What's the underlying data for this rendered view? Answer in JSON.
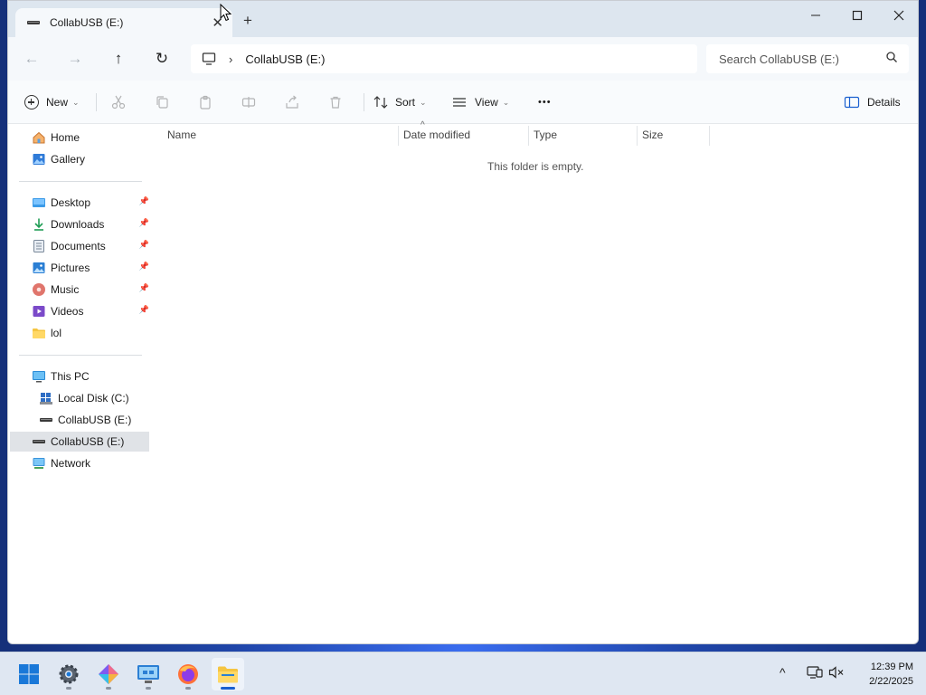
{
  "window": {
    "tab_title": "CollabUSB (E:)",
    "new_tab": "+",
    "minimize": "—",
    "maximize": "☐",
    "close": "✕"
  },
  "nav": {
    "back": "←",
    "forward": "→",
    "up": "↑",
    "refresh": "↻",
    "path_separator": "›",
    "path": "CollabUSB (E:)",
    "search_placeholder": "Search CollabUSB (E:)"
  },
  "commandbar": {
    "new_label": "New",
    "sort_label": "Sort",
    "view_label": "View",
    "more_label": "•••",
    "details_label": "Details",
    "dropdown_caret": "⌄"
  },
  "sidebar": {
    "quick": [
      {
        "label": "Home",
        "icon": "home-icon"
      },
      {
        "label": "Gallery",
        "icon": "gallery-icon"
      }
    ],
    "pinned": [
      {
        "label": "Desktop",
        "icon": "desktop-folder-icon",
        "pinned": true
      },
      {
        "label": "Downloads",
        "icon": "downloads-folder-icon",
        "pinned": true
      },
      {
        "label": "Documents",
        "icon": "documents-folder-icon",
        "pinned": true
      },
      {
        "label": "Pictures",
        "icon": "pictures-folder-icon",
        "pinned": true
      },
      {
        "label": "Music",
        "icon": "music-folder-icon",
        "pinned": true
      },
      {
        "label": "Videos",
        "icon": "videos-folder-icon",
        "pinned": true
      },
      {
        "label": "lol",
        "icon": "folder-icon",
        "pinned": false
      }
    ],
    "pin_glyph": "📌",
    "devices": [
      {
        "label": "This PC",
        "icon": "this-pc-icon"
      },
      {
        "label": "Local Disk (C:)",
        "icon": "local-disk-icon"
      },
      {
        "label": "CollabUSB (E:)",
        "icon": "usb-drive-icon"
      },
      {
        "label": "CollabUSB (E:)",
        "icon": "usb-drive-icon",
        "selected": true
      },
      {
        "label": "Network",
        "icon": "network-icon"
      }
    ]
  },
  "content": {
    "columns": [
      "Name",
      "Date modified",
      "Type",
      "Size"
    ],
    "sort_indicator": "^",
    "empty_message": "This folder is empty."
  },
  "taskbar": {
    "apps": [
      "start-icon",
      "settings-icon",
      "copilot-icon",
      "remote-desktop-icon",
      "firefox-icon",
      "file-explorer-icon"
    ],
    "tray_chevron": "^",
    "time": "12:39 PM",
    "date": "2/22/2025"
  },
  "colors": {
    "accent": "#1a5fcf",
    "titlebar_bg": "#dde6ef",
    "selection_bg": "#e0e3e7",
    "folder_yellow": "#f5c542"
  }
}
